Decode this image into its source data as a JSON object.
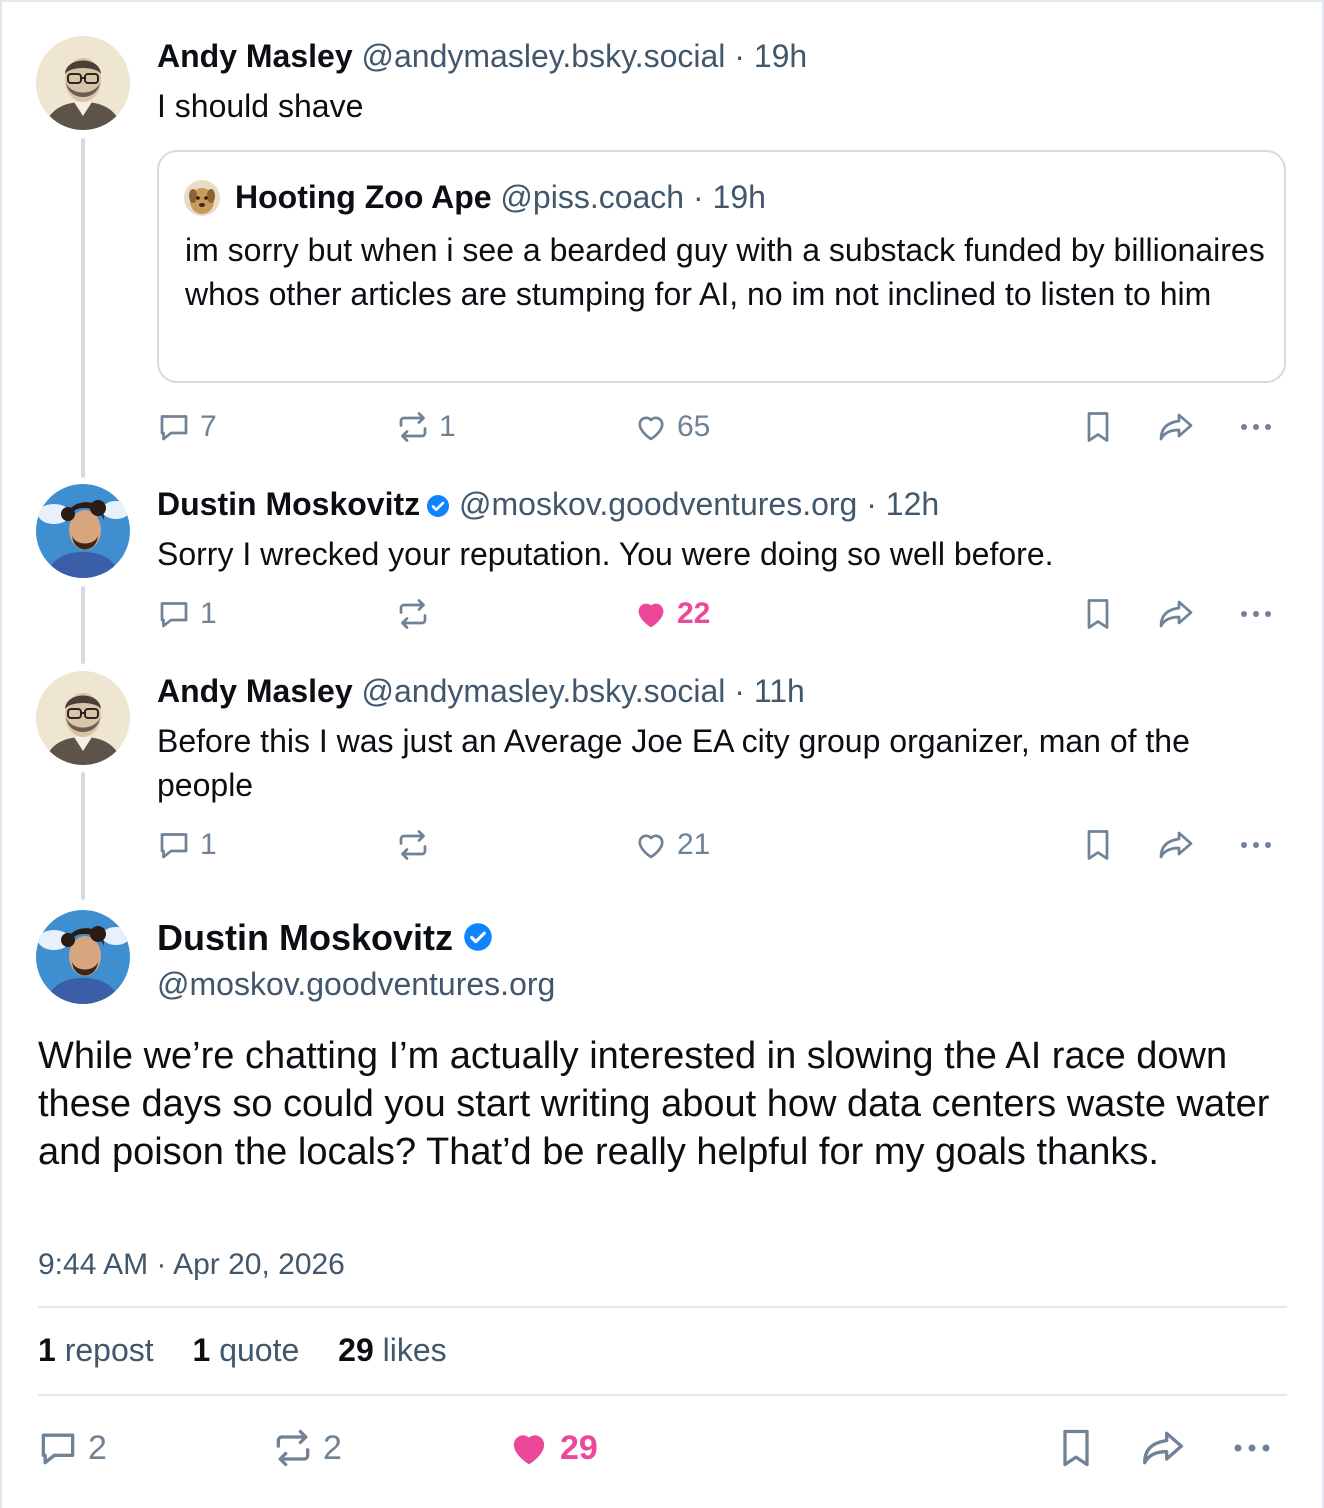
{
  "thread": [
    {
      "name": "Andy Masley",
      "handle": "@andymasley.bsky.social",
      "time": "19h",
      "text": "I should shave",
      "quote": {
        "name": "Hooting Zoo Ape",
        "handle": "@piss.coach",
        "time": "19h",
        "text": "im sorry but when i see a bearded guy with a substack funded by billionaires whos other articles are stumping for AI, no im not inclined to listen to him"
      },
      "replies": "7",
      "reposts": "1",
      "likes": "65",
      "liked": false
    },
    {
      "name": "Dustin Moskovitz",
      "verified": true,
      "handle": "@moskov.goodventures.org",
      "time": "12h",
      "text": "Sorry I wrecked your reputation. You were doing so well before.",
      "replies": "1",
      "reposts": "",
      "likes": "22",
      "liked": true
    },
    {
      "name": "Andy Masley",
      "handle": "@andymasley.bsky.social",
      "time": "11h",
      "text": "Before this I was just an Average Joe EA city group organizer, man of the people",
      "replies": "1",
      "reposts": "",
      "likes": "21",
      "liked": false
    }
  ],
  "main_post": {
    "name": "Dustin Moskovitz",
    "verified": true,
    "handle": "@moskov.goodventures.org",
    "text": "While we’re chatting I’m actually interested in slowing the AI race down these days so could you start writing about how data centers waste water and poison the locals? That’d be really helpful for my goals thanks.",
    "timestamp": "9:44 AM · Apr 20, 2026",
    "stats": {
      "reposts_count": "1",
      "reposts_label": "repost",
      "quotes_count": "1",
      "quotes_label": "quote",
      "likes_count": "29",
      "likes_label": "likes"
    },
    "actions": {
      "replies": "2",
      "reposts": "2",
      "likes": "29",
      "liked": true
    }
  },
  "separator": "·",
  "colors": {
    "text": "#0b0f14",
    "muted": "#42576c",
    "icon": "#6f8296",
    "like": "#ec4899",
    "verified": "#1083fe",
    "border": "#d4dbe2"
  },
  "icons": [
    "reply-icon",
    "repost-icon",
    "like-icon",
    "bookmark-icon",
    "share-icon",
    "more-icon",
    "verified-icon"
  ]
}
